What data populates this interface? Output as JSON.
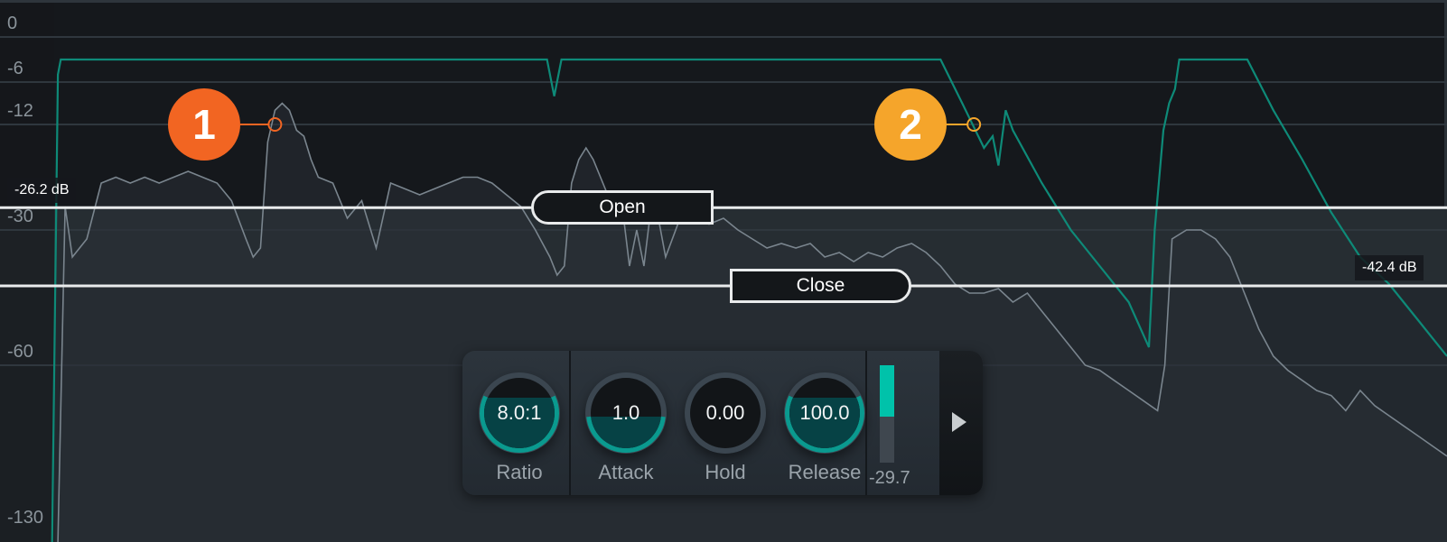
{
  "colors": {
    "background_top": "#15181c",
    "signal_fill": "#2a3037",
    "signal_line": "#7a858e",
    "gain_curve": "#0e8a78",
    "threshold_line": "#e9ebec",
    "grid": "#2f373e",
    "callout_1": "#f26522",
    "callout_2": "#f5a52b",
    "knob_active": "#0a9a8f",
    "meter": "#00c2aa"
  },
  "axis": {
    "ticks": [
      {
        "db": 0,
        "label": "0"
      },
      {
        "db": -6,
        "label": "-6"
      },
      {
        "db": -12,
        "label": "-12"
      },
      {
        "db": -30,
        "label": "-30"
      },
      {
        "db": -60,
        "label": "-60"
      },
      {
        "db": -130,
        "label": "-130"
      }
    ]
  },
  "thresholds": {
    "open": {
      "label": "Open",
      "value_db": -26.2,
      "readout": "-26.2 dB"
    },
    "close": {
      "label": "Close",
      "value_db": -42.4,
      "readout": "-42.4 dB"
    }
  },
  "callouts": [
    {
      "number": "1",
      "target_db": -12,
      "time": 0.19
    },
    {
      "number": "2",
      "target_db": -12,
      "time": 0.673
    }
  ],
  "panel": {
    "knobs": [
      {
        "name": "ratio",
        "label": "Ratio",
        "value": "8.0:1",
        "level": 0.72
      },
      {
        "name": "attack",
        "label": "Attack",
        "value": "1.0",
        "level": 0.45
      },
      {
        "name": "hold",
        "label": "Hold",
        "value": "0.00",
        "level": 0.0
      },
      {
        "name": "release",
        "label": "Release",
        "value": "100.0",
        "level": 0.72
      }
    ],
    "meter": {
      "value": "-29.7",
      "level": 0.53
    },
    "expand_icon": "play-triangle-icon"
  },
  "signal": {
    "time": [
      0.04,
      0.045,
      0.05,
      0.06,
      0.07,
      0.08,
      0.09,
      0.1,
      0.11,
      0.12,
      0.13,
      0.14,
      0.15,
      0.16,
      0.17,
      0.175,
      0.18,
      0.185,
      0.19,
      0.195,
      0.2,
      0.205,
      0.21,
      0.215,
      0.22,
      0.23,
      0.24,
      0.25,
      0.26,
      0.27,
      0.28,
      0.29,
      0.3,
      0.31,
      0.32,
      0.33,
      0.34,
      0.35,
      0.36,
      0.37,
      0.38,
      0.385,
      0.39,
      0.395,
      0.4,
      0.405,
      0.41,
      0.42,
      0.43,
      0.435,
      0.44,
      0.445,
      0.45,
      0.455,
      0.46,
      0.47,
      0.48,
      0.49,
      0.5,
      0.51,
      0.52,
      0.53,
      0.54,
      0.55,
      0.56,
      0.57,
      0.58,
      0.59,
      0.6,
      0.61,
      0.62,
      0.63,
      0.64,
      0.65,
      0.66,
      0.67,
      0.68,
      0.69,
      0.7,
      0.71,
      0.72,
      0.73,
      0.74,
      0.75,
      0.76,
      0.77,
      0.78,
      0.79,
      0.795,
      0.8,
      0.805,
      0.81,
      0.82,
      0.83,
      0.84,
      0.85,
      0.86,
      0.87,
      0.88,
      0.89,
      0.9,
      0.91,
      0.92,
      0.93,
      0.94,
      0.95,
      0.96,
      0.97,
      0.98,
      0.99,
      1.0
    ],
    "db": [
      -130,
      -26,
      -36,
      -32,
      -22,
      -21,
      -22,
      -21,
      -22,
      -21,
      -20,
      -21,
      -22,
      -25,
      -32,
      -36,
      -34,
      -15,
      -10,
      -9,
      -10,
      -13,
      -14,
      -18,
      -21,
      -22,
      -28,
      -25,
      -34,
      -22,
      -23,
      -24,
      -23,
      -22,
      -21,
      -21,
      -22,
      -24,
      -26,
      -30,
      -36,
      -40,
      -38,
      -22,
      -18,
      -16,
      -18,
      -24,
      -26,
      -38,
      -30,
      -38,
      -26,
      -28,
      -36,
      -28,
      -26,
      -29,
      -28,
      -30,
      -32,
      -34,
      -33,
      -34,
      -33,
      -36,
      -35,
      -37,
      -35,
      -36,
      -34,
      -33,
      -35,
      -38,
      -42,
      -44,
      -44,
      -43,
      -46,
      -44,
      -48,
      -52,
      -56,
      -60,
      -62,
      -66,
      -70,
      -74,
      -76,
      -78,
      -60,
      -32,
      -30,
      -30,
      -32,
      -36,
      -44,
      -52,
      -58,
      -62,
      -66,
      -70,
      -72,
      -78,
      -70,
      -76,
      -80,
      -84,
      -88,
      -92,
      -96
    ]
  },
  "gain_reduction": {
    "time": [
      0.036,
      0.04,
      0.042,
      0.37,
      0.378,
      0.383,
      0.388,
      0.65,
      0.665,
      0.68,
      0.686,
      0.69,
      0.695,
      0.7,
      0.72,
      0.74,
      0.76,
      0.78,
      0.794,
      0.798,
      0.804,
      0.808,
      0.812,
      0.815,
      0.862,
      0.88,
      0.9,
      0.92,
      0.94,
      0.96,
      0.98,
      1.0
    ],
    "db": [
      -130,
      -5,
      -3,
      -3,
      -3,
      -8,
      -3,
      -3,
      -9,
      -16,
      -14,
      -19,
      -10,
      -13,
      -22,
      -30,
      -38,
      -46,
      -56,
      -30,
      -13,
      -9,
      -7,
      -3,
      -3,
      -10,
      -18,
      -27,
      -36,
      -42,
      -50,
      -58
    ]
  }
}
